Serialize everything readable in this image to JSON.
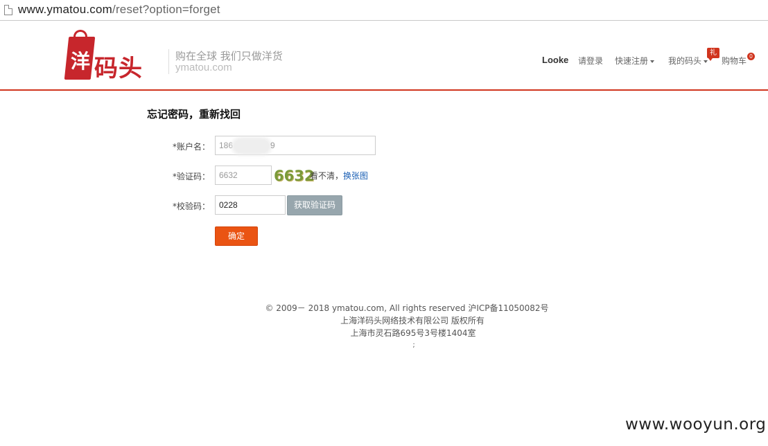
{
  "browser": {
    "url_host": "www.ymatou.com",
    "url_path": "/reset?option=forget"
  },
  "header": {
    "logo_char_bag": "洋",
    "logo_rest": "码头",
    "slogan": "购在全球 我们只做洋货",
    "domain": "ymatou.com",
    "nav": {
      "user": "Looke",
      "login": "请登录",
      "register": "快速注册",
      "mine": "我的码头",
      "gift_badge": "礼",
      "cart": "购物车",
      "cart_count": "0"
    },
    "accent_color": "#d0341d"
  },
  "form": {
    "title": "忘记密码，重新找回",
    "account_label": "*账户名：",
    "account_prefix": "186",
    "account_suffix": "9",
    "captcha_label": "*验证码：",
    "captcha_value": "6632",
    "captcha_image_text": "6632",
    "captcha_unclear": "看不清，",
    "captcha_change": "换张图",
    "verify_label": "*校验码：",
    "verify_value": "0228",
    "get_code_button": "获取验证码",
    "confirm_button": "确定"
  },
  "footer": {
    "line1": "© 2009－ 2018 ymatou.com, All rights reserved 沪ICP备11050082号",
    "line2": "上海洋码头网络技术有限公司 版权所有",
    "line3": "上海市灵石路695号3号楼1404室",
    "line4": ";"
  },
  "watermark": "www.wooyun.org"
}
